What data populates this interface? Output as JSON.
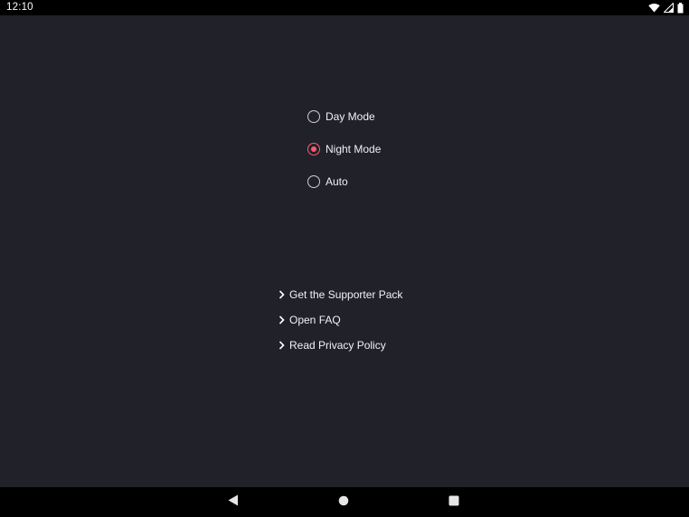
{
  "status_bar": {
    "time": "12:10",
    "icons": [
      "wifi-icon",
      "signal-icon",
      "battery-icon"
    ]
  },
  "theme_options": {
    "selected": "Night Mode",
    "accent_color": "#ff5a6e",
    "items": [
      {
        "label": "Day Mode",
        "checked": false
      },
      {
        "label": "Night Mode",
        "checked": true
      },
      {
        "label": "Auto",
        "checked": false
      }
    ]
  },
  "links": {
    "items": [
      {
        "label": "Get the Supporter Pack",
        "icon": "chevron-right-icon"
      },
      {
        "label": "Open FAQ",
        "icon": "chevron-right-icon"
      },
      {
        "label": "Read Privacy Policy",
        "icon": "chevron-right-icon"
      }
    ]
  },
  "nav_bar": {
    "buttons": [
      "back-icon",
      "home-icon",
      "recents-icon"
    ]
  }
}
